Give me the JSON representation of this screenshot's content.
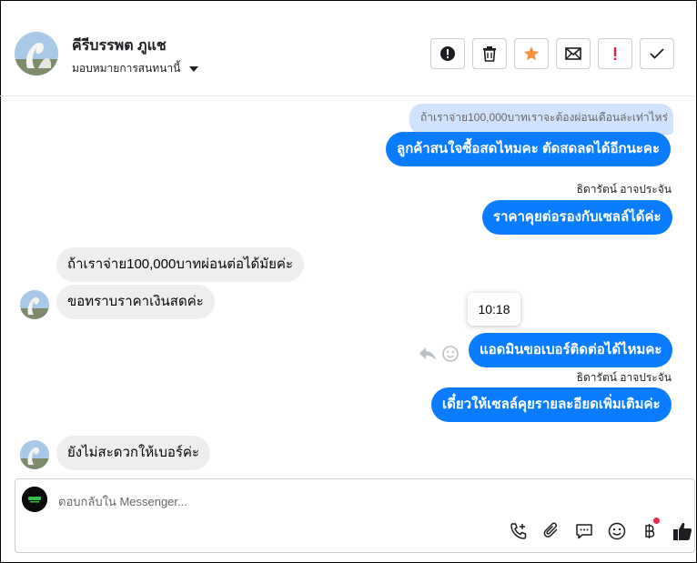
{
  "header": {
    "contact_name": "คีรีบรรพต ภูแช",
    "assign_label": "มอบหมายการสนทนานี้"
  },
  "actions": [
    {
      "icon": "alert-circle-icon",
      "label": "spam"
    },
    {
      "icon": "trash-icon",
      "label": "delete"
    },
    {
      "icon": "star-icon",
      "label": "star",
      "color": "#f7923b"
    },
    {
      "icon": "envelope-icon",
      "label": "mark-unread"
    },
    {
      "icon": "exclamation-icon",
      "label": "follow-up",
      "color": "#e41e3f"
    },
    {
      "icon": "check-icon",
      "label": "done"
    }
  ],
  "messages": {
    "reply_quote": "ถ้าเราจ่าย100,000บาทเราจะต้องผ่อนเดือนล่ะเท่าไหร่",
    "out1": "ลูกค้าสนใจซื้อสดไหมคะ ตัดสดลดได้อีกนะคะ",
    "sender1": "ธิดารัตน์ อาจประจัน",
    "out2": "ราคาคุยต่อรองกับเซลล์ได้ค่ะ",
    "in1": "ถ้าเราจ่าย100,000บาทผ่อนต่อได้มัยค่ะ",
    "in2": "ขอทราบราคาเงินสดค่ะ",
    "tooltip_time": "10:18",
    "out3": "แอดมินขอเบอร์ติดต่อได้ไหมคะ",
    "sender2": "ธิดารัตน์ อาจประจัน",
    "out4": "เดี๋ยวให้เซลล์คุยรายละอียดเพิ่มเติมค่ะ",
    "in3": "ยังไม่สะดวกให้เบอร์ค่ะ"
  },
  "composer": {
    "placeholder": "ตอบกลับใน Messenger..."
  },
  "toolbar_icons": [
    "phone-add-icon",
    "paperclip-icon",
    "saved-reply-icon",
    "emoji-icon",
    "baht-payment-icon",
    "thumbs-up-icon"
  ],
  "colors": {
    "accent": "#0a7cff",
    "reply_quote_bg": "#d1e3fc",
    "incoming_bg": "#eeeeef"
  }
}
